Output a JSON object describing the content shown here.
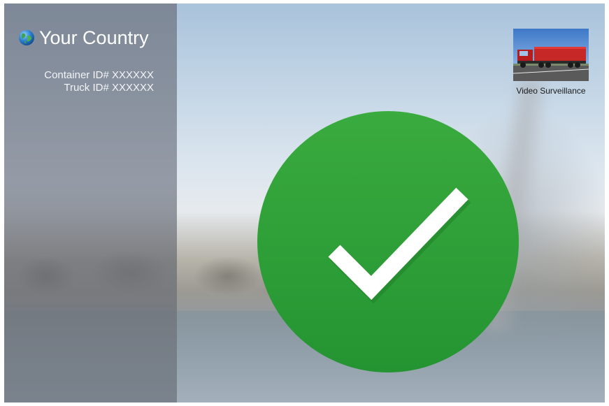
{
  "sidebar": {
    "country": "Your Country",
    "container_id": "Container ID# XXXXXX",
    "truck_id": "Truck ID# XXXXXX"
  },
  "video": {
    "label": "Video Surveillance"
  },
  "icons": {
    "globe": "globe-icon",
    "status": "check-icon",
    "thumbnail": "truck-thumbnail"
  },
  "colors": {
    "success_green": "#2f9e37",
    "sidebar_overlay": "#7a8290",
    "text_light": "#ffffff"
  }
}
